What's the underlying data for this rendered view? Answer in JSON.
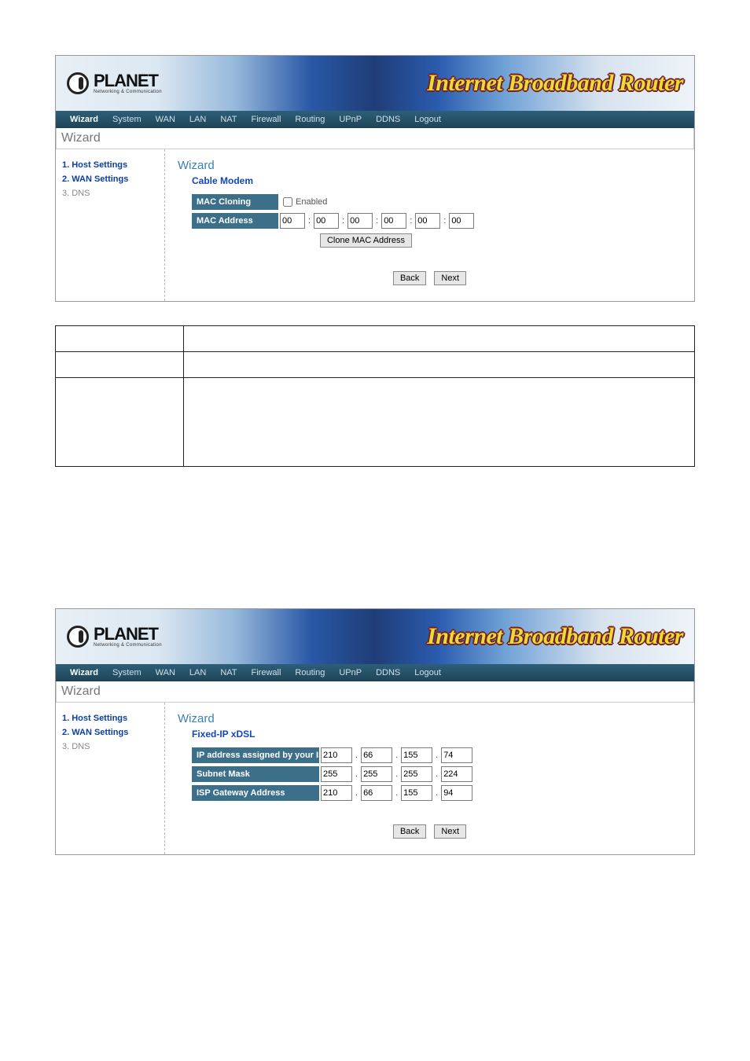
{
  "banner": {
    "brand_big": "PLANET",
    "brand_small": "Networking & Communication",
    "title": "Internet Broadband Router"
  },
  "nav": {
    "items": [
      "Wizard",
      "System",
      "WAN",
      "LAN",
      "NAT",
      "Firewall",
      "Routing",
      "UPnP",
      "DDNS",
      "Logout"
    ],
    "active": "Wizard"
  },
  "pagetitle": "Wizard",
  "sidebar": {
    "items": [
      {
        "label": "1. Host Settings",
        "active": true
      },
      {
        "label": "2. WAN Settings",
        "active": true
      },
      {
        "label": "3. DNS",
        "active": false
      }
    ]
  },
  "screen1": {
    "heading": "Wizard",
    "subheading": "Cable Modem",
    "mac_cloning_label": "MAC Cloning",
    "enabled_label": "Enabled",
    "mac_address_label": "MAC Address",
    "mac": [
      "00",
      "00",
      "00",
      "00",
      "00",
      "00"
    ],
    "clone_btn": "Clone MAC Address",
    "back": "Back",
    "next": "Next"
  },
  "screen2": {
    "heading": "Wizard",
    "subheading": "Fixed-IP xDSL",
    "rows": [
      {
        "label": "IP address assigned by your ISP",
        "ip": [
          "210",
          "66",
          "155",
          "74"
        ]
      },
      {
        "label": "Subnet Mask",
        "ip": [
          "255",
          "255",
          "255",
          "224"
        ]
      },
      {
        "label": "ISP Gateway Address",
        "ip": [
          "210",
          "66",
          "155",
          "94"
        ]
      }
    ],
    "back": "Back",
    "next": "Next"
  }
}
